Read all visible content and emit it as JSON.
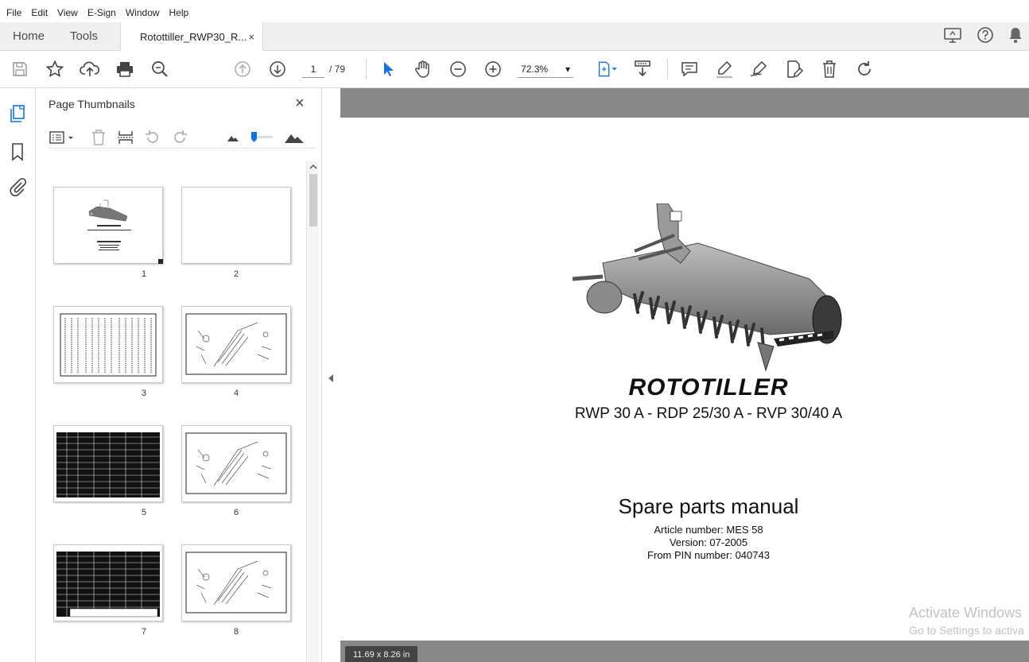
{
  "menu": [
    "File",
    "Edit",
    "View",
    "E-Sign",
    "Window",
    "Help"
  ],
  "tabs": {
    "home": "Home",
    "tools": "Tools",
    "document": "Rotottiller_RWP30_R...",
    "close_symbol": "×"
  },
  "toolbar": {
    "page_current": "1",
    "page_total": "/ 79",
    "zoom": "72.3%",
    "zoom_arrow": "▾"
  },
  "thumbnails": {
    "title": "Page Thumbnails",
    "close_symbol": "×",
    "pages": [
      "1",
      "2",
      "3",
      "4",
      "5",
      "6",
      "7",
      "8"
    ],
    "cover_title": "ROTOTILLER",
    "cover_sub": "RWP 30 A - RDP 25/30 A - RVP 30/40 A",
    "cover_manual": "Spare parts manual"
  },
  "document": {
    "title": "ROTOTILLER",
    "models": "RWP 30 A - RDP 25/30 A - RVP 30/40 A",
    "manual": "Spare parts manual",
    "article": "Article number: MES 58",
    "version": "Version: 07-2005",
    "pin": "From PIN number: 040743",
    "page_size": "11.69 x 8.26 in",
    "watermark_title": "Activate Windows",
    "watermark_sub": "Go to Settings to activa"
  },
  "colors": {
    "accent": "#1473e6",
    "doc_background": "#888888"
  }
}
